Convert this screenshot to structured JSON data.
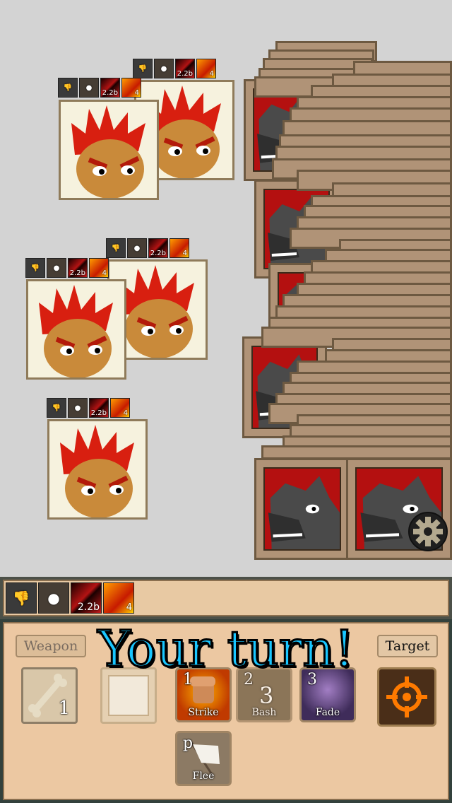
{
  "heroes": [
    {
      "buffs": [
        "thumbs-down",
        "fist",
        "2.2b",
        "4"
      ]
    },
    {
      "buffs": [
        "thumbs-down",
        "fist",
        "2.2b",
        "4"
      ]
    },
    {
      "buffs": [
        "thumbs-down",
        "fist",
        "2.2b",
        "4"
      ]
    },
    {
      "buffs": [
        "thumbs-down",
        "fist",
        "2.2b",
        "4"
      ]
    },
    {
      "buffs": [
        "thumbs-down",
        "fist",
        "2.2b",
        "4"
      ]
    }
  ],
  "buff_labels": {
    "slash": "2.2b",
    "fire": "4"
  },
  "status_bar": {
    "slash_value": "2.2b",
    "fire_value": "4"
  },
  "tabs": {
    "weapon": "Weapon",
    "target": "Target"
  },
  "banner": "Your turn!",
  "weapon_slot": {
    "count": "1"
  },
  "skills": [
    {
      "key": "1",
      "label": "Strike",
      "overlay": ""
    },
    {
      "key": "2",
      "label": "Bash",
      "overlay": "3"
    },
    {
      "key": "3",
      "label": "Fade",
      "overlay": ""
    },
    {
      "key": "p",
      "label": "Flee",
      "overlay": ""
    }
  ],
  "colors": {
    "accent": "#19c6ff",
    "bg": "#d3d3d3",
    "wolf_red": "#b41010",
    "panel": "#ecc8a2"
  }
}
